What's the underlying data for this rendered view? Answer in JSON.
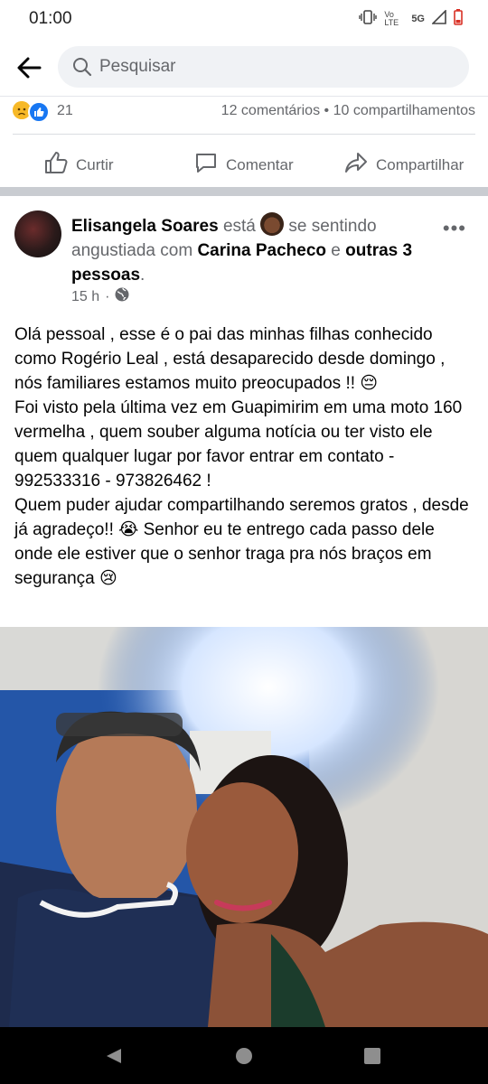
{
  "status_bar": {
    "time": "01:00",
    "network": "5G",
    "volte": "Vo LTE",
    "icons": [
      "vibrate-icon",
      "signal-icon",
      "battery-icon"
    ]
  },
  "search": {
    "placeholder": "Pesquisar"
  },
  "reactions": {
    "count": "21",
    "comments": "12 comentários",
    "separator": "•",
    "shares": "10 compartilhamentos"
  },
  "actions": {
    "like": "Curtir",
    "comment": "Comentar",
    "share": "Compartilhar"
  },
  "post": {
    "author": "Elisangela Soares",
    "is_text": "está",
    "feeling": "se sentindo angustiada com",
    "tagged": "Carina Pacheco",
    "and": "e",
    "others": "outras 3 pessoas",
    "period": ".",
    "time": "15 h",
    "dot": "·",
    "more": "•••",
    "body": "Olá pessoal , esse é o pai das minhas filhas conhecido como Rogério Leal , está desaparecido desde domingo , nós familiares estamos muito preocupados !! 😔\nFoi visto pela última vez em Guapimirim em uma moto 160 vermelha , quem souber alguma notícia ou ter visto ele quem qualquer lugar por favor entrar em contato - 992533316 - 973826462 !\nQuem puder ajudar compartilhando seremos gratos , desde já agradeço!! 😭  Senhor eu te entrego cada passo dele onde ele estiver que o senhor traga pra nós braços em segurança 😢"
  },
  "colors": {
    "facebook_blue": "#1877f2",
    "meta_gray": "#65676b",
    "divider": "#c9ccd1"
  }
}
